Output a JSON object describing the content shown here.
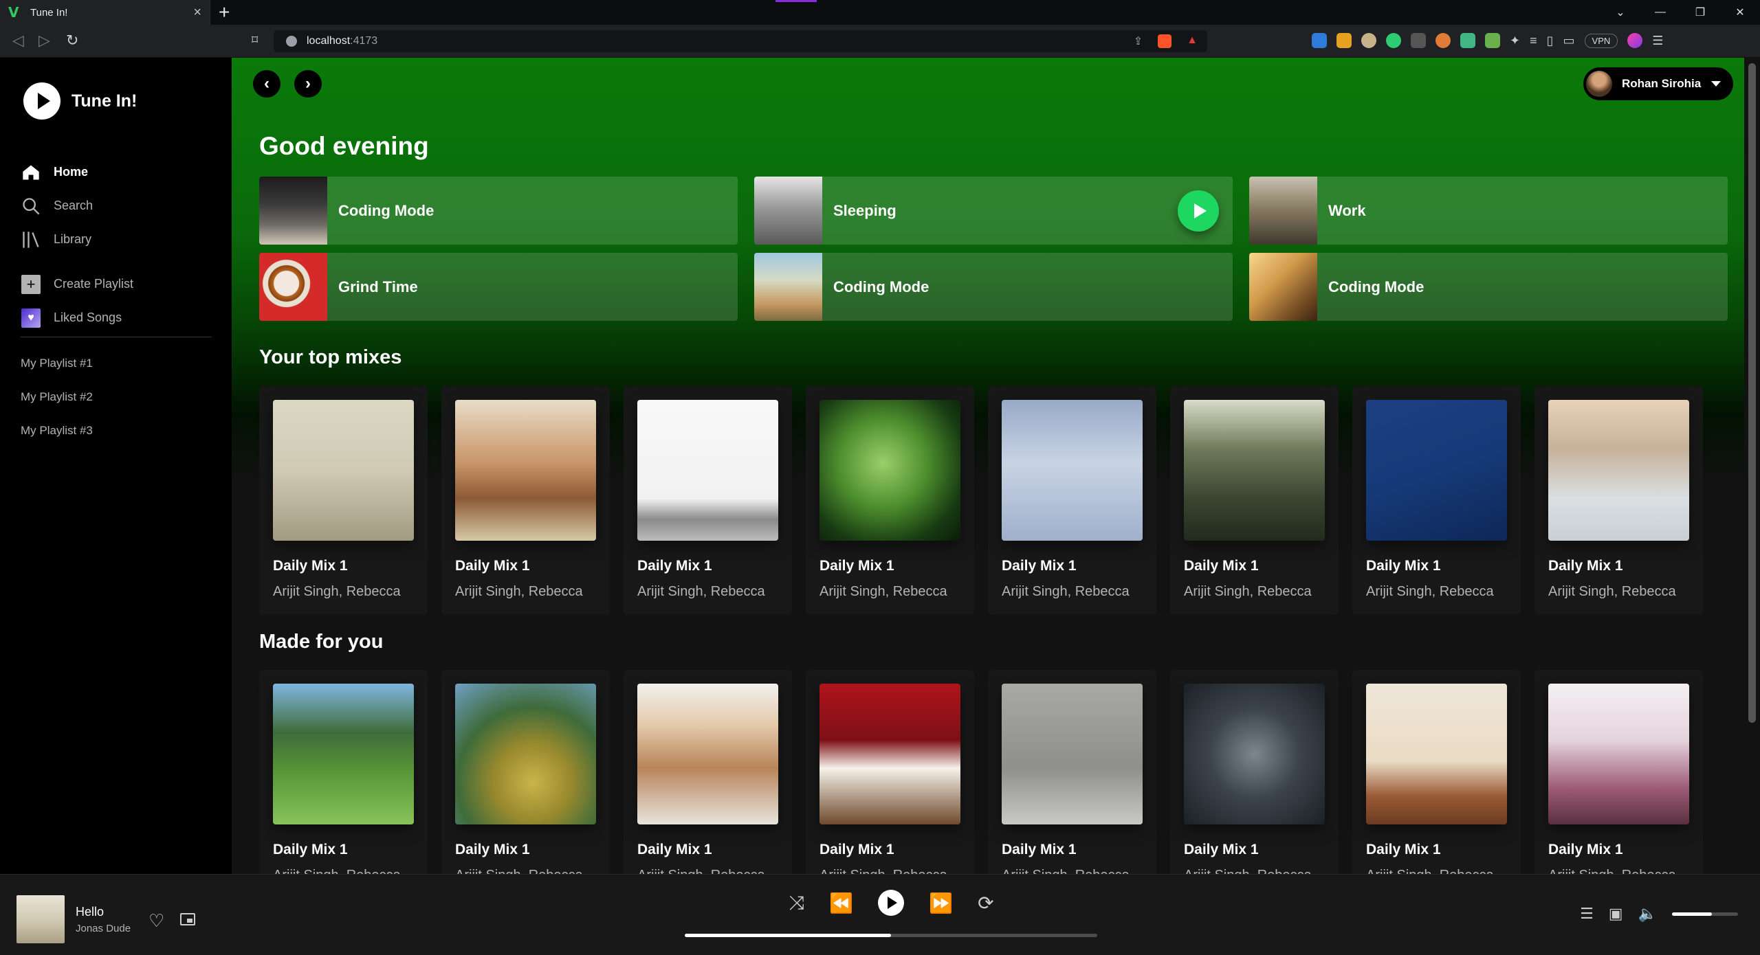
{
  "browser": {
    "tab_title": "Tune In!",
    "tab_favicon": "V",
    "tab_close": "×",
    "new_tab": "+",
    "url_host": "localhost",
    "url_port": ":4173",
    "vpn_label": "VPN"
  },
  "app": {
    "name": "Tune In!"
  },
  "sidebar": {
    "nav": [
      {
        "label": "Home",
        "icon": "home-icon",
        "active": true
      },
      {
        "label": "Search",
        "icon": "search-icon",
        "active": false
      },
      {
        "label": "Library",
        "icon": "library-icon",
        "active": false
      }
    ],
    "actions": [
      {
        "label": "Create Playlist",
        "icon": "plus-icon",
        "color": "#b3b3b3"
      },
      {
        "label": "Liked Songs",
        "icon": "heart-icon",
        "color": "#5b3fd6"
      }
    ],
    "playlists": [
      "My Playlist #1",
      "My Playlist #2",
      "My Playlist #3"
    ]
  },
  "header": {
    "back": "‹",
    "forward": "›",
    "user_name": "Rohan Sirohia"
  },
  "greeting": "Good evening",
  "quick_picks": [
    {
      "title": "Coding Mode",
      "art": "linear-gradient(180deg,#1c1c1c 0%,#3a3a3a 40%,#6d6a64 70%,#cfc7b6 100%)"
    },
    {
      "title": "Sleeping",
      "art": "linear-gradient(180deg,#e6e6e6 0%,#9a9a9a 45%,#5a5a5a 100%)",
      "playing": true
    },
    {
      "title": "Work",
      "art": "linear-gradient(180deg,#c7c2b3 0%,#8b7e64 45%,#3f3a2f 100%)"
    },
    {
      "title": "Grind Time",
      "art": "radial-gradient(circle at 40% 45%,#f2e8e0 0,#f2e8e0 18px,#b5651d 19px,#8b4513 26px,#e8e0d0 27px,#e8e0d0 34px,#d42a2a 35px)"
    },
    {
      "title": "Coding Mode",
      "art": "linear-gradient(180deg,#9fc7e0 0%,#d5dbc2 40%,#c79a63 75%,#7d6a3f 100%)"
    },
    {
      "title": "Coding Mode",
      "art": "linear-gradient(135deg,#f7d78e 0%,#d29a4b 40%,#6b4520 80%,#3a2412 100%)"
    }
  ],
  "sections": [
    {
      "title": "Your top mixes",
      "items": [
        {
          "title": "Daily Mix 1",
          "subtitle": "Arijit Singh, Rebecca",
          "art": "linear-gradient(180deg,#dcd8c4 0%,#cfcab4 50%,#a39b80 100%)"
        },
        {
          "title": "Daily Mix 1",
          "subtitle": "Arijit Singh, Rebecca",
          "art": "linear-gradient(180deg,#e8ddc7 0%,#c89468 45%,#8c5a35 70%,#d8c9a8 100%)"
        },
        {
          "title": "Daily Mix 1",
          "subtitle": "Arijit Singh, Rebecca",
          "art": "linear-gradient(180deg,#f8f8f8 0%,#f2f2f2 70%,#8a8a8a 85%,#bdbdbd 100%)"
        },
        {
          "title": "Daily Mix 1",
          "subtitle": "Arijit Singh, Rebecca",
          "art": "radial-gradient(circle at 45% 45%,#9bcf6a 0,#4e8f2e 40%,#173b12 75%,#0b1a08 100%)"
        },
        {
          "title": "Daily Mix 1",
          "subtitle": "Arijit Singh, Rebecca",
          "art": "linear-gradient(180deg,#98aac8 0%,#c9d3e3 45%,#9fb0cc 100%)"
        },
        {
          "title": "Daily Mix 1",
          "subtitle": "Arijit Singh, Rebecca",
          "art": "linear-gradient(180deg,#d9dcc8 0%,#6f7a5a 35%,#3c4531 70%,#222a1d 100%)"
        },
        {
          "title": "Daily Mix 1",
          "subtitle": "Arijit Singh, Rebecca",
          "art": "linear-gradient(160deg,#1c3f80 0%,#163a78 50%,#0e2757 100%)"
        },
        {
          "title": "Daily Mix 1",
          "subtitle": "Arijit Singh, Rebecca",
          "art": "linear-gradient(180deg,#e8d2b8 0%,#c6b29a 35%,#dadfe2 70%,#c9cfd4 100%)"
        }
      ]
    },
    {
      "title": "Made for you",
      "items": [
        {
          "title": "Daily Mix 1",
          "subtitle": "Arijit Singh, Rebecca",
          "art": "linear-gradient(180deg,#7fb6e0 0%,#3f6b3a 35%,#5a9a38 65%,#88c25a 100%)"
        },
        {
          "title": "Daily Mix 1",
          "subtitle": "Arijit Singh, Rebecca",
          "art": "radial-gradient(circle at 55% 70%,#c9b54a 0,#9a8a2e 30%,#3e6b3a 60%,#6fa0c4 100%)"
        },
        {
          "title": "Daily Mix 1",
          "subtitle": "Arijit Singh, Rebecca",
          "art": "linear-gradient(180deg,#f1f1ef 0%,#e3c8a8 30%,#b8855a 60%,#e7e4de 100%)"
        },
        {
          "title": "Daily Mix 1",
          "subtitle": "Arijit Singh, Rebecca",
          "art": "linear-gradient(180deg,#b0141c 0%,#7e0f16 40%,#f5f1ea 60%,#6e4a2c 100%)"
        },
        {
          "title": "Daily Mix 1",
          "subtitle": "Arijit Singh, Rebecca",
          "art": "linear-gradient(180deg,#a8a8a6 0%,#8f8f8c 60%,#c9c9c6 100%)"
        },
        {
          "title": "Daily Mix 1",
          "subtitle": "Arijit Singh, Rebecca",
          "art": "radial-gradient(circle at 50% 50%,#7d8790 0,#3c444b 45%,#1b2025 100%)"
        },
        {
          "title": "Daily Mix 1",
          "subtitle": "Arijit Singh, Rebecca",
          "art": "linear-gradient(180deg,#efe6d8 0%,#e9dcc4 55%,#9a5a36 80%,#6b3b22 100%)"
        },
        {
          "title": "Daily Mix 1",
          "subtitle": "Arijit Singh, Rebecca",
          "art": "linear-gradient(180deg,#f4f0f2 0%,#e6d3dc 40%,#9b5a73 75%,#5a2f40 100%)"
        }
      ]
    }
  ],
  "player": {
    "title": "Hello",
    "artist": "Jonas Dude",
    "progress": 0.5,
    "volume": 0.6
  }
}
